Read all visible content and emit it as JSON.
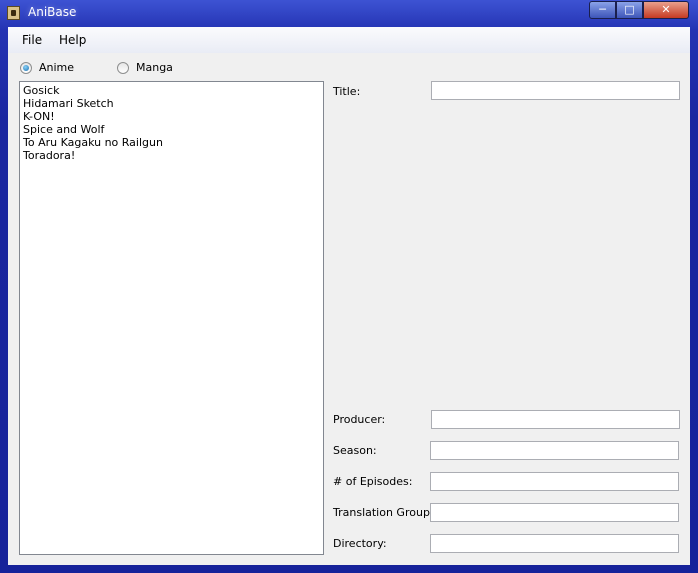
{
  "window": {
    "title": "AniBase"
  },
  "menu": {
    "file": "File",
    "help": "Help"
  },
  "mode": {
    "anime_label": "Anime",
    "manga_label": "Manga",
    "selected": "Anime"
  },
  "list": {
    "items": [
      "Gosick",
      "Hidamari Sketch",
      "K-ON!",
      "Spice and Wolf",
      "To Aru Kagaku no Railgun",
      "Toradora!"
    ]
  },
  "fields": {
    "title_label": "Title:",
    "producer_label": "Producer:",
    "season_label": "Season:",
    "episodes_label": "# of Episodes:",
    "translation_label": "Translation Group:",
    "directory_label": "Directory:",
    "title_value": "",
    "producer_value": "",
    "season_value": "",
    "episodes_value": "",
    "translation_value": "",
    "directory_value": ""
  },
  "colors": {
    "titlebar": "#2433b3",
    "client_bg": "#f0f0f0",
    "close_button": "#c63a22"
  }
}
